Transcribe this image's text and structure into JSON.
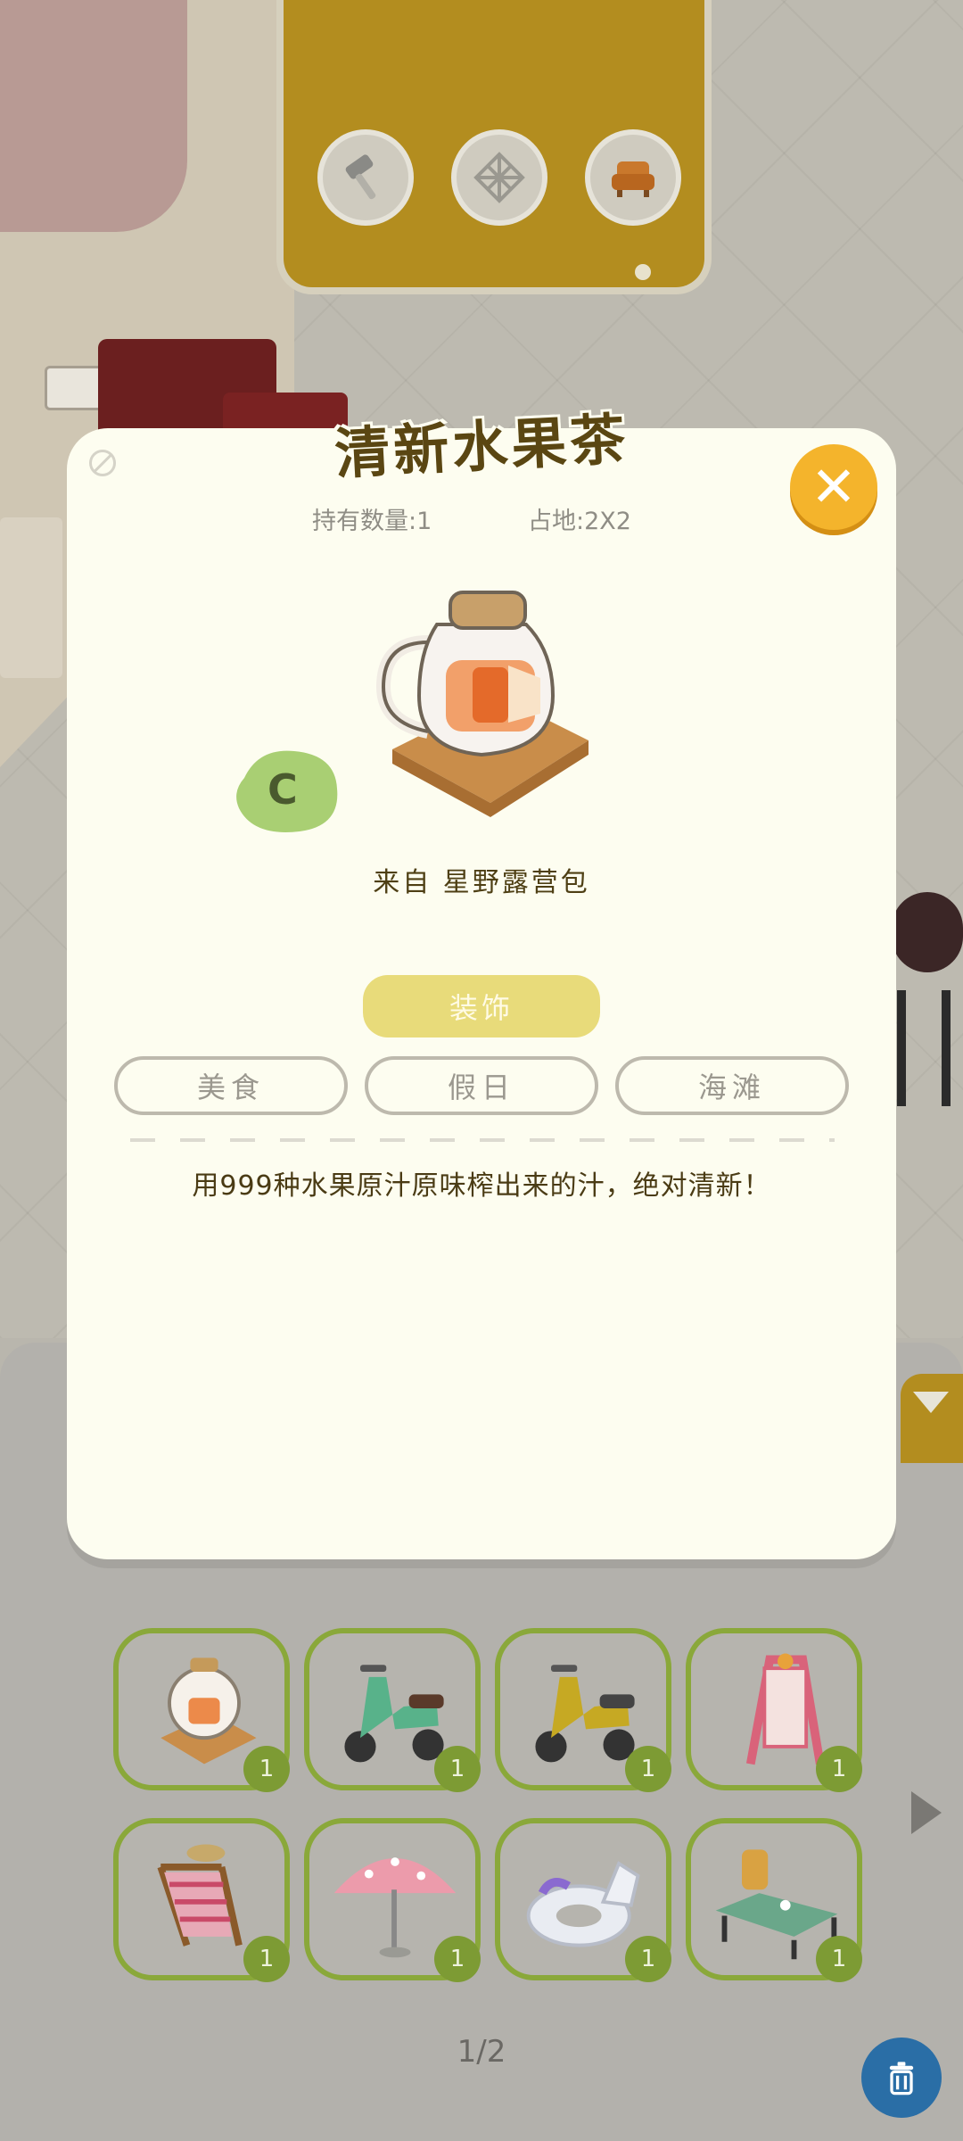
{
  "build_panel": {
    "tools": [
      {
        "icon": "hammer-icon"
      },
      {
        "icon": "floor-grid-icon"
      },
      {
        "icon": "sofa-icon"
      }
    ]
  },
  "item_detail": {
    "title": "清新水果茶",
    "owned_label": "持有数量:1",
    "footprint_label": "占地:2X2",
    "grade": "C",
    "source": "来自  星野露营包",
    "category": "装饰",
    "tags": [
      "美食",
      "假日",
      "海滩"
    ],
    "description": "用999种水果原汁原味榨出来的汁，绝对清新！",
    "colors": {
      "card": "#fdfdf0",
      "close": "#f4b42c",
      "category": "#e8db7a",
      "grade": "#a9cf73"
    }
  },
  "inventory": {
    "items": [
      {
        "name": "fruit-tea-item",
        "count": "1"
      },
      {
        "name": "green-scooter-item",
        "count": "1"
      },
      {
        "name": "yellow-scooter-item",
        "count": "1"
      },
      {
        "name": "menu-board-item",
        "count": "1"
      },
      {
        "name": "beach-chair-item",
        "count": "1"
      },
      {
        "name": "beach-umbrella-item",
        "count": "1"
      },
      {
        "name": "unicorn-float-item",
        "count": "1"
      },
      {
        "name": "picnic-table-item",
        "count": "1"
      }
    ],
    "page": "1/2"
  }
}
